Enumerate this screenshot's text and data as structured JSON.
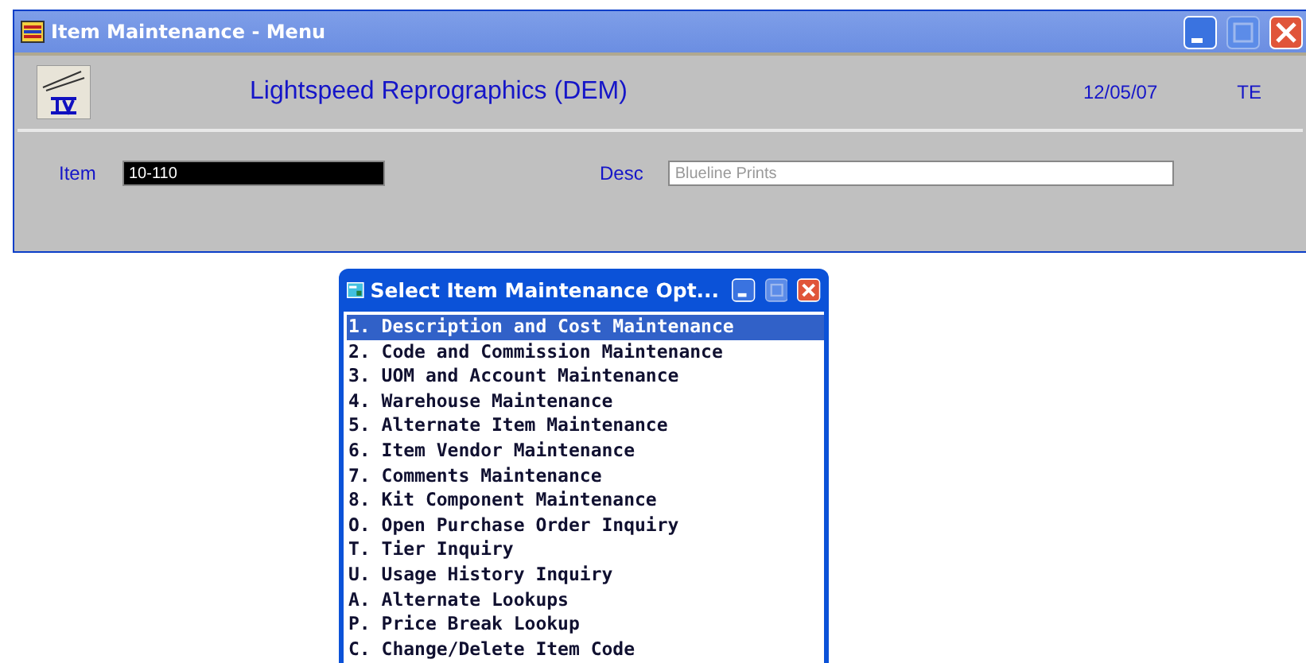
{
  "window": {
    "title": "Item Maintenance - Menu"
  },
  "header": {
    "company": "Lightspeed Reprographics (DEM)",
    "date": "12/05/07",
    "user": "TE"
  },
  "fields": [
    {
      "label": "Item",
      "value": "10-110",
      "kind": "selected"
    },
    {
      "label": "Desc",
      "value": "Blueline Prints",
      "kind": "readonly"
    }
  ],
  "dialog": {
    "title": "Select Item Maintenance Opt...",
    "options": [
      {
        "label": "1. Description and Cost Maintenance",
        "selected": true
      },
      {
        "label": "2. Code and Commission Maintenance",
        "selected": false
      },
      {
        "label": "3. UOM and Account Maintenance",
        "selected": false
      },
      {
        "label": "4. Warehouse Maintenance",
        "selected": false
      },
      {
        "label": "5. Alternate Item Maintenance",
        "selected": false
      },
      {
        "label": "6. Item Vendor Maintenance",
        "selected": false
      },
      {
        "label": "7. Comments Maintenance",
        "selected": false
      },
      {
        "label": "8. Kit Component Maintenance",
        "selected": false
      },
      {
        "label": "O. Open Purchase Order Inquiry",
        "selected": false
      },
      {
        "label": "T. Tier Inquiry",
        "selected": false
      },
      {
        "label": "U. Usage History Inquiry",
        "selected": false
      },
      {
        "label": "A. Alternate Lookups",
        "selected": false
      },
      {
        "label": "P. Price Break Lookup",
        "selected": false
      },
      {
        "label": "C. Change/Delete Item Code",
        "selected": false
      }
    ]
  }
}
